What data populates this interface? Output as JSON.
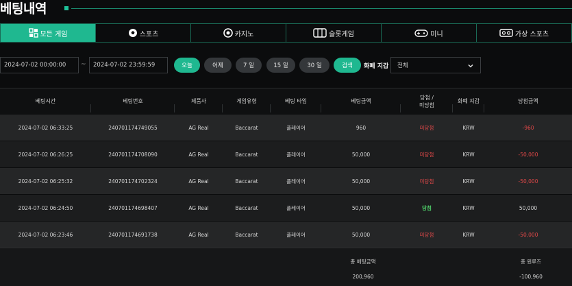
{
  "page": {
    "title": "베팅내역"
  },
  "tabs": [
    {
      "label": "모든 게임",
      "icon": "grid-icon",
      "active": true
    },
    {
      "label": "스포츠",
      "icon": "soccer-ball-icon"
    },
    {
      "label": "카지노",
      "icon": "casino-chip-icon"
    },
    {
      "label": "슬롯게임",
      "icon": "slot-machine-icon"
    },
    {
      "label": "미니",
      "icon": "gamepad-icon"
    },
    {
      "label": "가상 스포츠",
      "icon": "vr-headset-icon"
    }
  ],
  "filters": {
    "start_date": "2024-07-02 00:00:00",
    "separator": "~",
    "end_date": "2024-07-02 23:59:59",
    "buttons": [
      "오늘",
      "어제",
      "7 일",
      "15 일",
      "30 일"
    ],
    "search_label": "검색",
    "currency_label": "화폐 지갑",
    "currency_value": "전체"
  },
  "table": {
    "headers": [
      "베팅시간",
      "베팅번호",
      "제품사",
      "게임유형",
      "베팅 타입",
      "베팅금액",
      "당첨 /\n미당첨",
      "화폐 지갑",
      "당첨금액"
    ],
    "rows": [
      [
        "2024-07-02 06:33:25",
        "240701174749055",
        "AG Real",
        "Baccarat",
        "플레이어",
        "960",
        "미당첨",
        "KRW",
        "-960"
      ],
      [
        "2024-07-02 06:26:25",
        "240701174708090",
        "AG Real",
        "Baccarat",
        "플레이어",
        "50,000",
        "미당첨",
        "KRW",
        "-50,000"
      ],
      [
        "2024-07-02 06:25:32",
        "240701174702324",
        "AG Real",
        "Baccarat",
        "플레이어",
        "50,000",
        "미당첨",
        "KRW",
        "-50,000"
      ],
      [
        "2024-07-02 06:24:50",
        "240701174698407",
        "AG Real",
        "Baccarat",
        "플레이어",
        "50,000",
        "당첨",
        "KRW",
        "50,000"
      ],
      [
        "2024-07-02 06:23:46",
        "240701174691738",
        "AG Real",
        "Baccarat",
        "플레이어",
        "50,000",
        "미당첨",
        "KRW",
        "-50,000"
      ]
    ]
  },
  "summary": {
    "total_bet_label": "총 베팅금액",
    "total_bet_value": "200,960",
    "total_win_label": "총 윈루즈",
    "total_win_value": "-100,960"
  },
  "colors": {
    "accent": "#1fb890",
    "lose": "#e04848",
    "win": "#4fd06a"
  }
}
